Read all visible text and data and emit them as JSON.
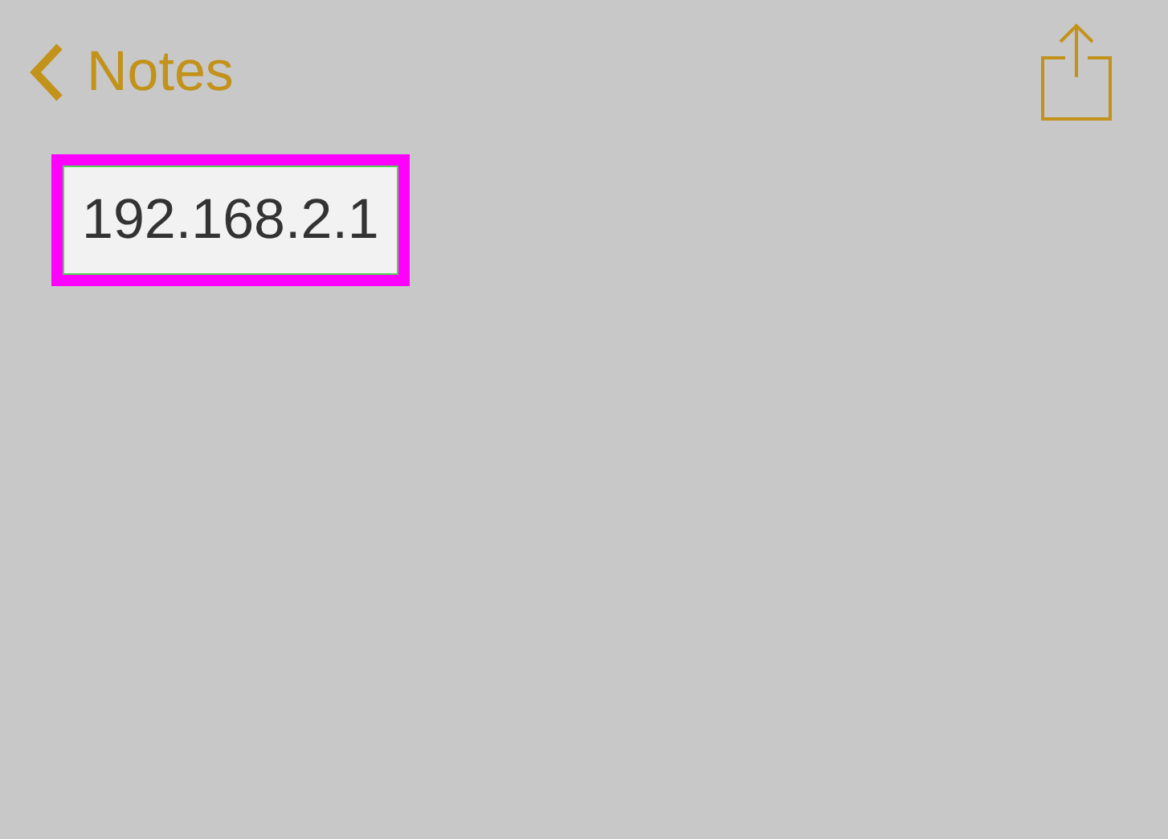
{
  "nav": {
    "back_label": "Notes"
  },
  "note": {
    "text": "192.168.2.1",
    "highlighted": true
  }
}
